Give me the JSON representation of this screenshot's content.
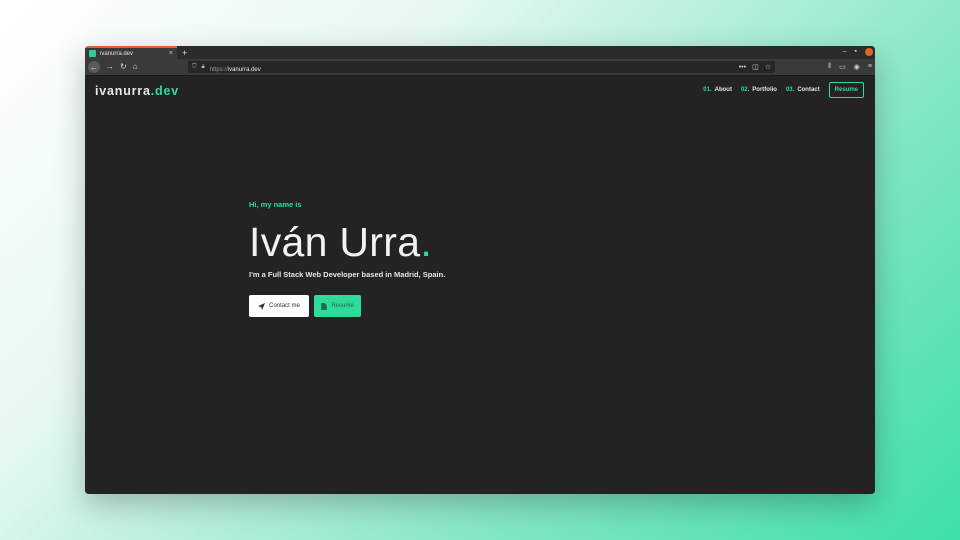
{
  "browser": {
    "tab_title": "ivanurra.dev",
    "tab_close": "×",
    "new_tab": "+",
    "url_scheme": "https://",
    "url_host": "ivanurra.dev",
    "url_more": "•••",
    "win_min": "–",
    "win_max": "▪"
  },
  "site": {
    "logo_main": "ivanurra",
    "logo_accent": ".dev",
    "nav": [
      {
        "num": "01.",
        "label": "About"
      },
      {
        "num": "02.",
        "label": "Portfolio"
      },
      {
        "num": "03.",
        "label": "Contact"
      }
    ],
    "nav_resume": "Resume"
  },
  "hero": {
    "greeting": "Hi, my name is",
    "name": "Iván Urra",
    "name_dot": ".",
    "tagline": "I'm a Full Stack Web Developer based in Madrid, Spain.",
    "contact_label": "Contact me",
    "resume_label": "Resume"
  },
  "colors": {
    "accent": "#2fdb9a",
    "page_bg": "#232323",
    "browser_chrome": "#3a3a3a"
  }
}
